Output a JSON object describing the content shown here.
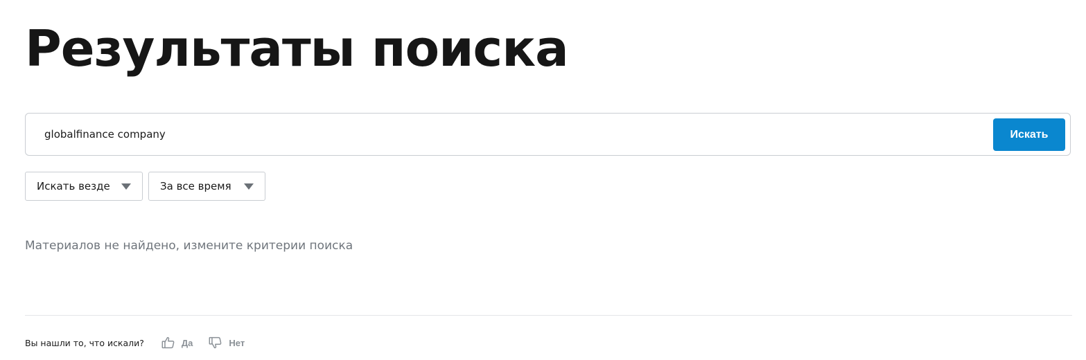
{
  "page": {
    "title": "Результаты поиска"
  },
  "search": {
    "value": "globalfinance company",
    "button_label": "Искать"
  },
  "filters": {
    "scope": {
      "selected": "Искать везде",
      "icon": "chevron-down-icon"
    },
    "period": {
      "selected": "За все время",
      "icon": "chevron-down-icon"
    }
  },
  "results": {
    "empty_message": "Материалов не найдено, измените критерии поиска"
  },
  "feedback": {
    "question": "Вы нашли то, что искали?",
    "yes": {
      "label": "Да",
      "icon": "thumbs-up-icon"
    },
    "no": {
      "label": "Нет",
      "icon": "thumbs-down-icon"
    }
  },
  "colors": {
    "accent": "#0a87cf",
    "muted_text": "#6f757c",
    "border": "#c9cdd2",
    "feedback_text": "#8a9096"
  }
}
